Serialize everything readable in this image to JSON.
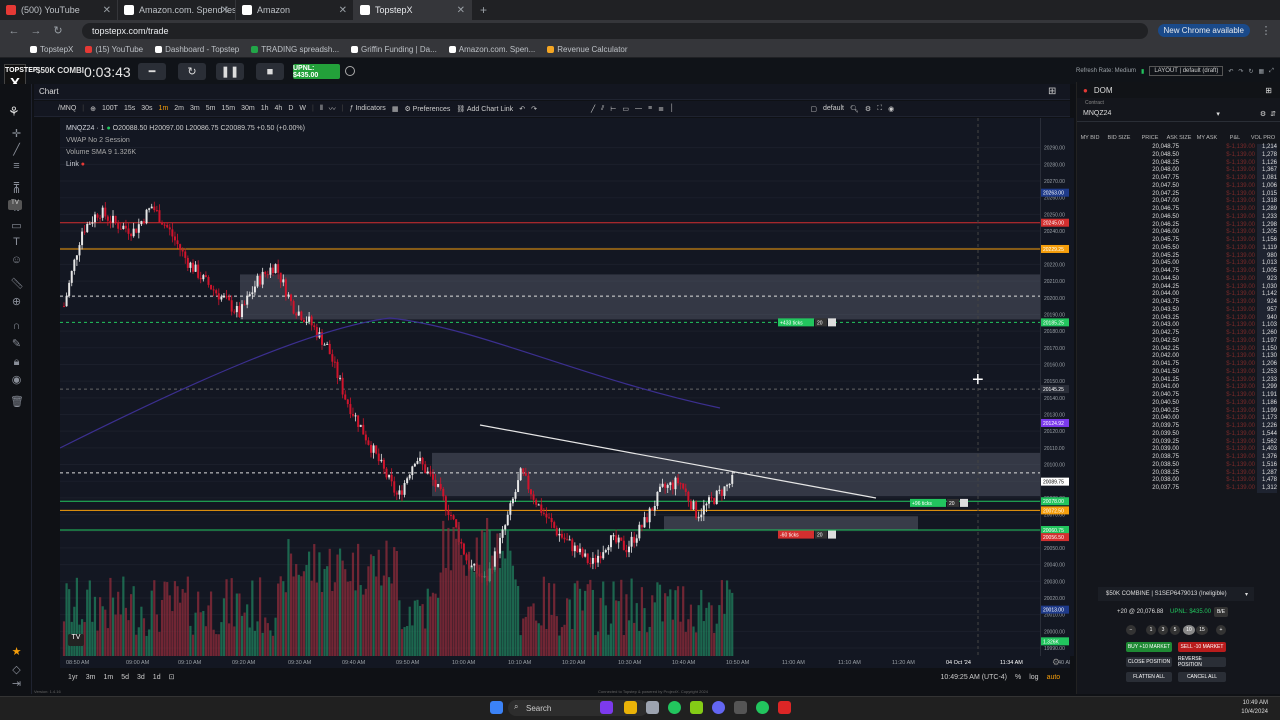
{
  "browser": {
    "tabs": [
      {
        "label": "(500) YouTube",
        "color": "#e53935"
      },
      {
        "label": "Amazon.com. Spend less. Smile",
        "color": "#ffffff"
      },
      {
        "label": "Amazon",
        "color": "#ffffff"
      },
      {
        "label": "TopstepX",
        "color": "#ffffff"
      }
    ],
    "url": "topstepx.com/trade",
    "new_chrome": "New Chrome available",
    "bookmarks": [
      "TopstepX",
      "(15) YouTube",
      "Dashboard - Topstep",
      "TRADING spreadsh...",
      "Griffin Funding | Da...",
      "Amazon.com. Spen...",
      "Revenue Calculator"
    ]
  },
  "app": {
    "logo_top": "TOPSTEP",
    "logo_mark": "X",
    "account_short": "$50K COMBI",
    "timer": "0:03:43",
    "upnl": "UPNL: $435.00",
    "rhead_label": "Refresh Rate: Medium",
    "layout": "LAYOUT | default (draft)"
  },
  "chart": {
    "tab": "Chart",
    "symbol": "/MNQ",
    "toolbar": [
      "100T",
      "15s",
      "30s",
      "1m",
      "2m",
      "3m",
      "5m",
      "15m",
      "30m",
      "1h",
      "4h",
      "D",
      "W"
    ],
    "indicators": "Indicators",
    "preferences": "Preferences",
    "add_link": "Add Chart Link",
    "layout_name": "default",
    "legend_symbol": "MNQZ24 · 1",
    "legend_ohlc": "O20088.50 H20097.00 L20086.75 C20089.75 +0.50 (+0.00%)",
    "legend_vwap": "VWAP  No 2  Session",
    "legend_volume": "Volume  SMA 9   1.326K",
    "legend_link": "Link",
    "time_labels": [
      "08:50 AM",
      "09:00 AM",
      "09:10 AM",
      "09:20 AM",
      "09:30 AM",
      "09:40 AM",
      "09:50 AM",
      "10:00 AM",
      "10:10 AM",
      "10:20 AM",
      "10:30 AM",
      "10:40 AM",
      "10:50 AM",
      "11:00 AM",
      "11:10 AM",
      "11:20 AM",
      "04 Oct '24",
      "11:34 AM",
      "40 AM"
    ],
    "price_ticks": [
      "20290.00",
      "20280.00",
      "20270.00",
      "20260.00",
      "20250.00",
      "20240.00",
      "20230.00",
      "20220.00",
      "20210.00",
      "20200.00",
      "20190.00",
      "20180.00",
      "20170.00",
      "20160.00",
      "20150.00",
      "20140.00",
      "20130.00",
      "20120.00",
      "20110.00",
      "20100.00",
      "20090.00",
      "20080.00",
      "20070.00",
      "20060.00",
      "20050.00",
      "20040.00",
      "20030.00",
      "20020.00",
      "20010.00",
      "20000.00",
      "19990.00"
    ],
    "price_badges": [
      {
        "label": "High",
        "value": "20263.00",
        "color": "#1e3a8a"
      },
      {
        "value": "20245.00",
        "color": "#d32f2f"
      },
      {
        "value": "20229.25",
        "color": "#f59e0b"
      },
      {
        "value": "20185.25",
        "color": "#22c55e"
      },
      {
        "value": "20145.25",
        "color": "#2a2e39"
      },
      {
        "value": "20124.92",
        "color": "#7c3aed"
      },
      {
        "value": "20089.75",
        "color": "#ffffff"
      },
      {
        "value": "20078.00",
        "color": "#22c55e"
      },
      {
        "value": "20072.50",
        "color": "#f59e0b"
      },
      {
        "value": "20060.75",
        "color": "#22c55e"
      },
      {
        "value": "20056.50",
        "color": "#d32f2f"
      },
      {
        "label": "Low",
        "value": "20013.00",
        "color": "#1e3a8a"
      },
      {
        "value": "1.326K",
        "color": "#22c55e"
      }
    ],
    "order_tags": [
      {
        "label": "+433 ticks",
        "qty": "20",
        "color": "#22c55e"
      },
      {
        "label": "+96 ticks",
        "qty": "20",
        "color": "#22c55e"
      },
      {
        "label": "-60 ticks",
        "qty": "20",
        "color": "#d32f2f"
      }
    ],
    "ranges": [
      "1yr",
      "3m",
      "1m",
      "5d",
      "3d",
      "1d"
    ],
    "clock": "10:49:25 AM (UTC-4)",
    "pct": "%",
    "log": "log",
    "auto": "auto",
    "footer": "Connected to Topstep & powered by ProjectX. Copyright 2024",
    "version": "Version: 1.4.16",
    "high_price": 20263.0,
    "low_price": 20013.0,
    "ylim": [
      19990,
      20290
    ]
  },
  "dom": {
    "title": "DOM",
    "contract_label": "Contract",
    "contract": "MNQZ24",
    "headers": [
      "MY BID",
      "BID SIZE",
      "PRICE",
      "ASK SIZE",
      "MY ASK",
      "P&L",
      "VOL PRO"
    ],
    "rows": [
      [
        "20,048.75",
        "1,214"
      ],
      [
        "20,048.50",
        "1,278"
      ],
      [
        "20,048.25",
        "1,126"
      ],
      [
        "20,048.00",
        "1,367"
      ],
      [
        "20,047.75",
        "1,081"
      ],
      [
        "20,047.50",
        "1,006"
      ],
      [
        "20,047.25",
        "1,015"
      ],
      [
        "20,047.00",
        "1,318"
      ],
      [
        "20,046.75",
        "1,289"
      ],
      [
        "20,046.50",
        "1,233"
      ],
      [
        "20,046.25",
        "1,298"
      ],
      [
        "20,046.00",
        "1,205"
      ],
      [
        "20,045.75",
        "1,156"
      ],
      [
        "20,045.50",
        "1,119"
      ],
      [
        "20,045.25",
        "980"
      ],
      [
        "20,045.00",
        "1,013"
      ],
      [
        "20,044.75",
        "1,005"
      ],
      [
        "20,044.50",
        "923"
      ],
      [
        "20,044.25",
        "1,030"
      ],
      [
        "20,044.00",
        "1,142"
      ],
      [
        "20,043.75",
        "924"
      ],
      [
        "20,043.50",
        "957"
      ],
      [
        "20,043.25",
        "940"
      ],
      [
        "20,043.00",
        "1,103"
      ],
      [
        "20,042.75",
        "1,260"
      ],
      [
        "20,042.50",
        "1,197"
      ],
      [
        "20,042.25",
        "1,150"
      ],
      [
        "20,042.00",
        "1,130"
      ],
      [
        "20,041.75",
        "1,206"
      ],
      [
        "20,041.50",
        "1,253"
      ],
      [
        "20,041.25",
        "1,233"
      ],
      [
        "20,041.00",
        "1,299"
      ],
      [
        "20,040.75",
        "1,191"
      ],
      [
        "20,040.50",
        "1,186"
      ],
      [
        "20,040.25",
        "1,199"
      ],
      [
        "20,040.00",
        "1,173"
      ],
      [
        "20,039.75",
        "1,226"
      ],
      [
        "20,039.50",
        "1,544"
      ],
      [
        "20,039.25",
        "1,562"
      ],
      [
        "20,039.00",
        "1,403"
      ],
      [
        "20,038.75",
        "1,376"
      ],
      [
        "20,038.50",
        "1,516"
      ],
      [
        "20,038.25",
        "1,287"
      ],
      [
        "20,038.00",
        "1,478"
      ],
      [
        "20,037.75",
        "1,312"
      ]
    ],
    "account": "$50K COMBINE | S1SEP6479013 (Ineligible)",
    "position": "+20 @ 20,076.88",
    "pos_upnl": "UPNL: $435.00",
    "be": "B/E",
    "qty_buttons": [
      "1",
      "3",
      "5",
      "10",
      "15"
    ],
    "buy": "BUY +10 MARKET",
    "sell": "SELL -10 MARKET",
    "close": "CLOSE POSITION",
    "reverse": "REVERSE POSITION",
    "flatten": "FLATTEN ALL",
    "cancel": "CANCEL ALL"
  },
  "taskbar": {
    "search": "Search",
    "time": "10:49 AM",
    "date": "10/4/2024"
  }
}
